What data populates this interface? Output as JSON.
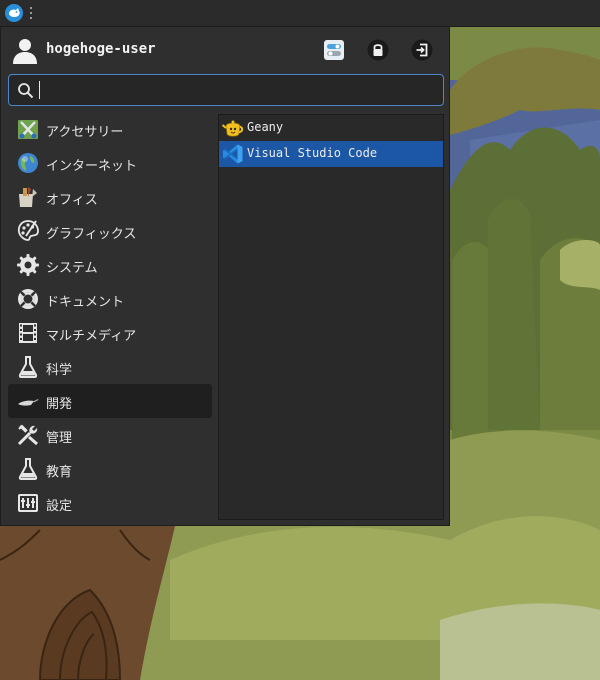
{
  "panel": {
    "launcher_icon": "xfce-mouse-icon",
    "handle_icon": "panel-handle-icon"
  },
  "menu": {
    "user": {
      "name": "hogehoge-user",
      "avatar_icon": "user-avatar-icon"
    },
    "header_buttons": [
      {
        "icon": "settings-toggle-icon"
      },
      {
        "icon": "lock-icon"
      },
      {
        "icon": "logout-icon"
      }
    ],
    "search": {
      "value": "",
      "placeholder": ""
    },
    "categories": [
      {
        "label": "アクセサリー",
        "icon": "accessories-icon"
      },
      {
        "label": "インターネット",
        "icon": "internet-globe-icon"
      },
      {
        "label": "オフィス",
        "icon": "office-icon"
      },
      {
        "label": "グラフィックス",
        "icon": "graphics-palette-icon"
      },
      {
        "label": "システム",
        "icon": "system-gear-icon"
      },
      {
        "label": "ドキュメント",
        "icon": "help-lifebuoy-icon"
      },
      {
        "label": "マルチメディア",
        "icon": "multimedia-film-icon"
      },
      {
        "label": "科学",
        "icon": "science-flask-icon"
      },
      {
        "label": "開発",
        "icon": "development-trowel-icon",
        "active": true
      },
      {
        "label": "管理",
        "icon": "tools-wrench-icon"
      },
      {
        "label": "教育",
        "icon": "education-flask-icon"
      },
      {
        "label": "設定",
        "icon": "settings-panel-icon"
      }
    ],
    "apps": [
      {
        "label": "Geany",
        "icon": "geany-teapot-icon"
      },
      {
        "label": "Visual Studio Code",
        "icon": "vscode-icon",
        "selected": true
      }
    ]
  },
  "colors": {
    "selection": "#1c57a5",
    "search_border": "#4e87c7",
    "menu_bg": "#2f2f2f",
    "panel_bg": "#2b2b2b"
  }
}
